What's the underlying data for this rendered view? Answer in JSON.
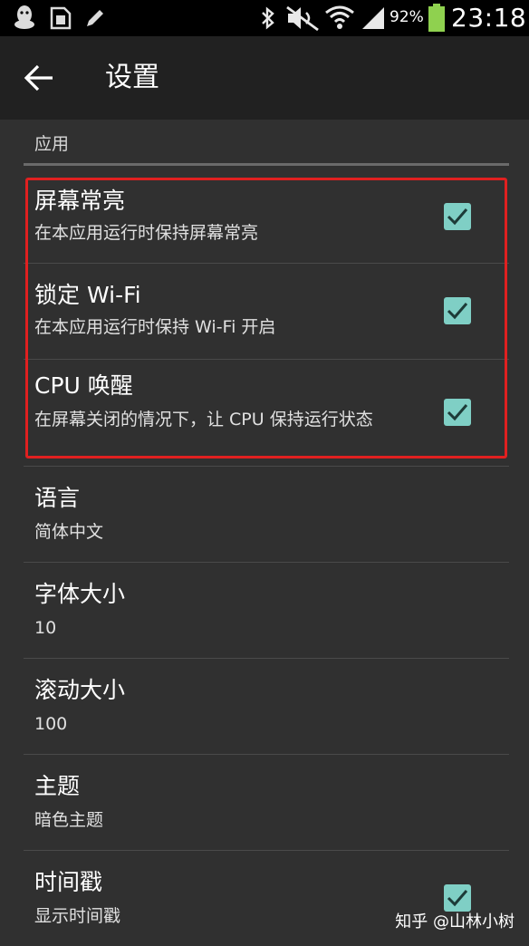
{
  "status_bar": {
    "battery": "92%",
    "time": "23:18",
    "icons": [
      "qq-icon",
      "sim-card-icon",
      "pen-icon",
      "bluetooth-icon",
      "mute-icon",
      "wifi-icon",
      "signal-icon",
      "battery-icon"
    ]
  },
  "app_bar": {
    "title": "设置",
    "back_icon": "back-arrow-icon"
  },
  "section": {
    "header": "应用"
  },
  "items": [
    {
      "title": "屏幕常亮",
      "summary": "在本应用运行时保持屏幕常亮",
      "checked": true
    },
    {
      "title": "锁定 Wi-Fi",
      "summary": "在本应用运行时保持 Wi-Fi 开启",
      "checked": true
    },
    {
      "title": "CPU 唤醒",
      "summary": "在屏幕关闭的情况下，让 CPU 保持运行状态",
      "checked": true
    },
    {
      "title": "语言",
      "summary": "简体中文"
    },
    {
      "title": "字体大小",
      "summary": "10"
    },
    {
      "title": "滚动大小",
      "summary": "100"
    },
    {
      "title": "主题",
      "summary": "暗色主题"
    },
    {
      "title": "时间戳",
      "summary": "显示时间戳",
      "checked": true
    }
  ],
  "colors": {
    "checkbox": "#7fcfc5",
    "highlight": "#e02020",
    "app_bar": "#212121",
    "background": "#303030"
  },
  "watermark": "知乎 @山林小树"
}
